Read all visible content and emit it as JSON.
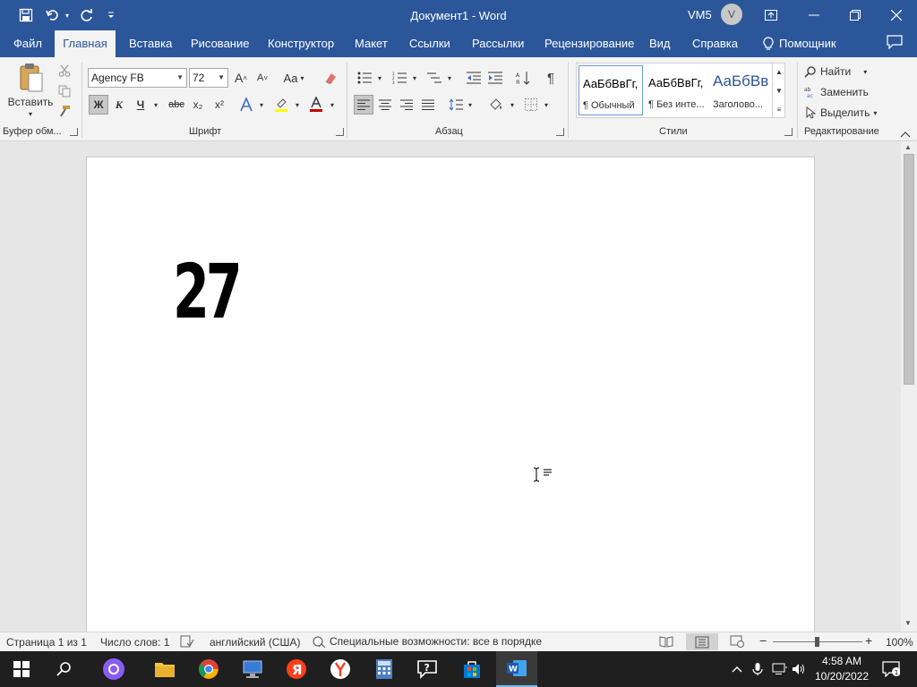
{
  "titlebar": {
    "title": "Документ1  -  Word",
    "user": "VM5",
    "avatar_initial": "V"
  },
  "tabs": [
    {
      "label": "Файл"
    },
    {
      "label": "Главная"
    },
    {
      "label": "Вставка"
    },
    {
      "label": "Рисование"
    },
    {
      "label": "Конструктор"
    },
    {
      "label": "Макет"
    },
    {
      "label": "Ссылки"
    },
    {
      "label": "Рассылки"
    },
    {
      "label": "Рецензирование"
    },
    {
      "label": "Вид"
    },
    {
      "label": "Справка"
    },
    {
      "label": "Помощник"
    }
  ],
  "ribbon": {
    "clipboard": {
      "paste_label": "Вставить",
      "group_label": "Буфер обм..."
    },
    "font": {
      "family": "Agency FB",
      "size": "72",
      "group_label": "Шрифт",
      "bold": "Ж",
      "italic": "К",
      "underline": "Ч",
      "strike": "abc",
      "sub": "x₂",
      "sup": "x²",
      "grow": "A",
      "shrink": "A",
      "case": "Aa"
    },
    "paragraph": {
      "group_label": "Абзац"
    },
    "styles": {
      "group_label": "Стили",
      "items": [
        {
          "preview": "АаБбВвГг,",
          "name": "¶ Обычный"
        },
        {
          "preview": "АаБбВвГг,",
          "name": "¶ Без инте..."
        },
        {
          "preview": "АаБбВв",
          "name": "Заголово..."
        }
      ]
    },
    "editing": {
      "group_label": "Редактирование",
      "find": "Найти",
      "replace": "Заменить",
      "select": "Выделить"
    }
  },
  "document": {
    "content": "27"
  },
  "statusbar": {
    "page": "Страница 1 из 1",
    "words": "Число слов: 1",
    "language": "английский (США)",
    "accessibility": "Специальные возможности: все в порядке",
    "zoom": "100%"
  },
  "taskbar": {
    "time": "4:58 AM",
    "date": "10/20/2022"
  },
  "colors": {
    "word_blue": "#2b579a",
    "ribbon_bg": "#f3f3f3",
    "taskbar_bg": "#1f1f1f"
  }
}
